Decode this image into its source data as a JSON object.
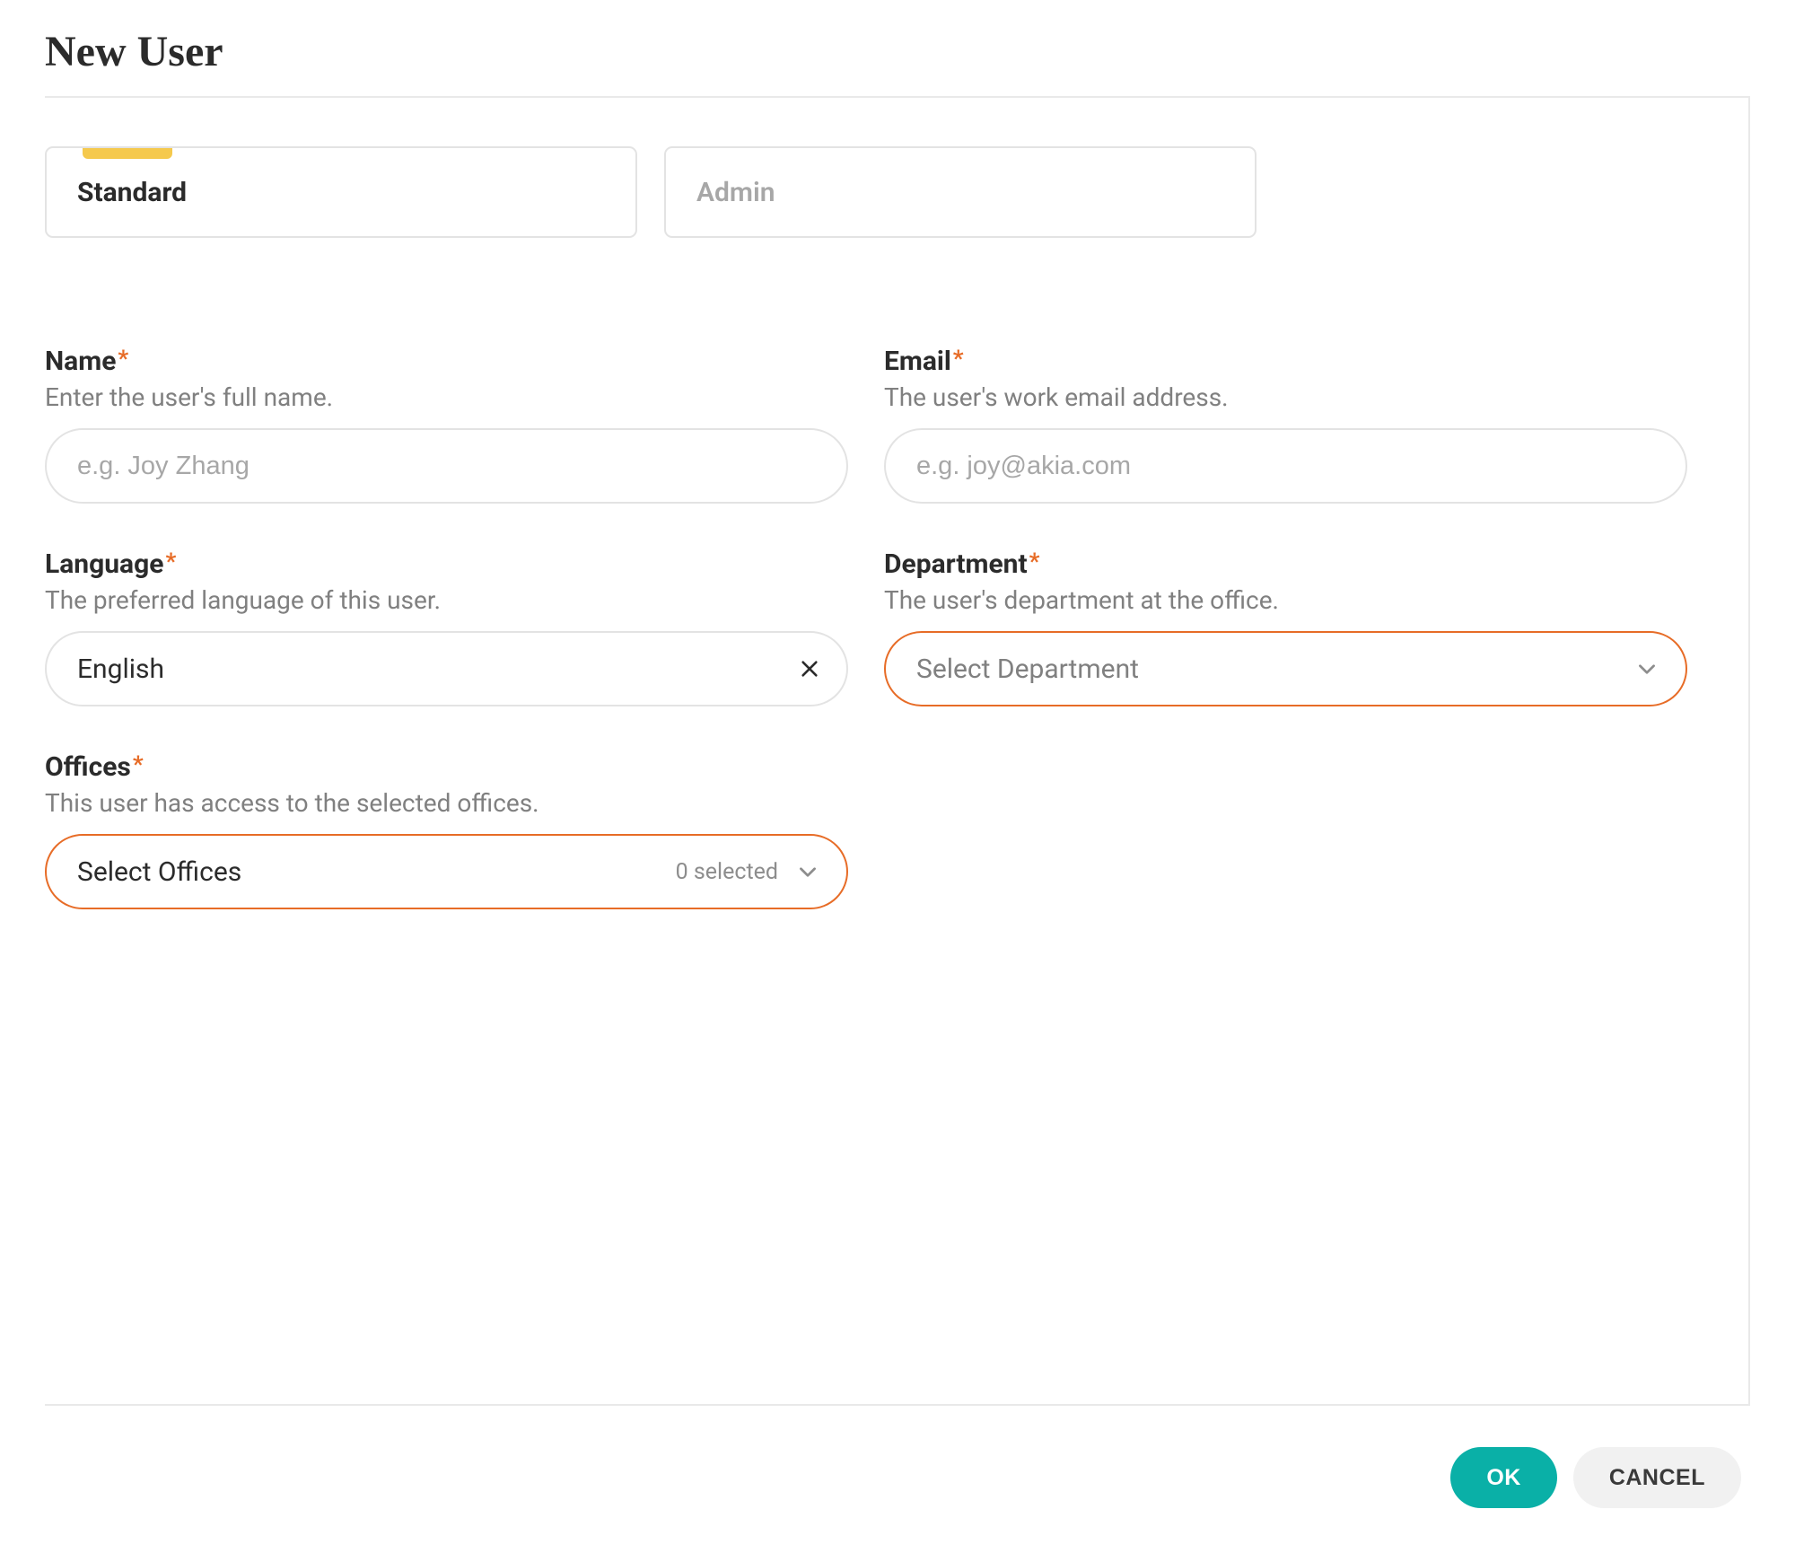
{
  "title": "New User",
  "typeToggle": {
    "standard": "Standard",
    "admin": "Admin"
  },
  "fields": {
    "name": {
      "label": "Name",
      "required": "*",
      "help": "Enter the user's full name.",
      "placeholder": "e.g. Joy Zhang",
      "value": ""
    },
    "email": {
      "label": "Email",
      "required": "*",
      "help": "The user's work email address.",
      "placeholder": "e.g. joy@akia.com",
      "value": ""
    },
    "language": {
      "label": "Language",
      "required": "*",
      "help": "The preferred language of this user.",
      "value": "English"
    },
    "department": {
      "label": "Department",
      "required": "*",
      "help": "The user's department at the office.",
      "placeholder": "Select Department"
    },
    "offices": {
      "label": "Offices",
      "required": "*",
      "help": "This user has access to the selected offices.",
      "placeholder": "Select Offices",
      "countText": "0 selected"
    }
  },
  "footer": {
    "ok": "OK",
    "cancel": "CANCEL"
  }
}
